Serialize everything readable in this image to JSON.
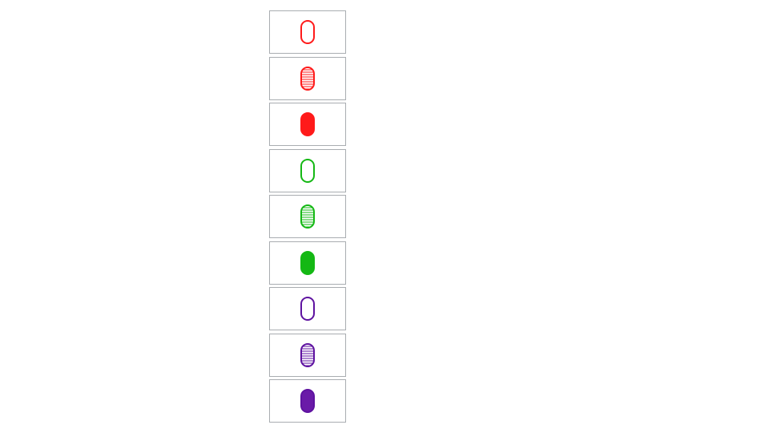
{
  "game": "set-style-cards",
  "colors": {
    "red": "#ff1a1a",
    "green": "#14b814",
    "purple": "#5e12a0",
    "purple_fill": "#6a1aa8",
    "card_border": "#a9adb1"
  },
  "cards": [
    {
      "count": 1,
      "shape": "oval",
      "color": "red",
      "shading": "empty"
    },
    {
      "count": 1,
      "shape": "oval",
      "color": "red",
      "shading": "striped"
    },
    {
      "count": 1,
      "shape": "oval",
      "color": "red",
      "shading": "solid"
    },
    {
      "count": 1,
      "shape": "oval",
      "color": "green",
      "shading": "empty"
    },
    {
      "count": 1,
      "shape": "oval",
      "color": "green",
      "shading": "striped"
    },
    {
      "count": 1,
      "shape": "oval",
      "color": "green",
      "shading": "solid"
    },
    {
      "count": 1,
      "shape": "oval",
      "color": "purple",
      "shading": "empty"
    },
    {
      "count": 1,
      "shape": "oval",
      "color": "purple",
      "shading": "striped"
    },
    {
      "count": 1,
      "shape": "oval",
      "color": "purple",
      "shading": "solid"
    }
  ]
}
